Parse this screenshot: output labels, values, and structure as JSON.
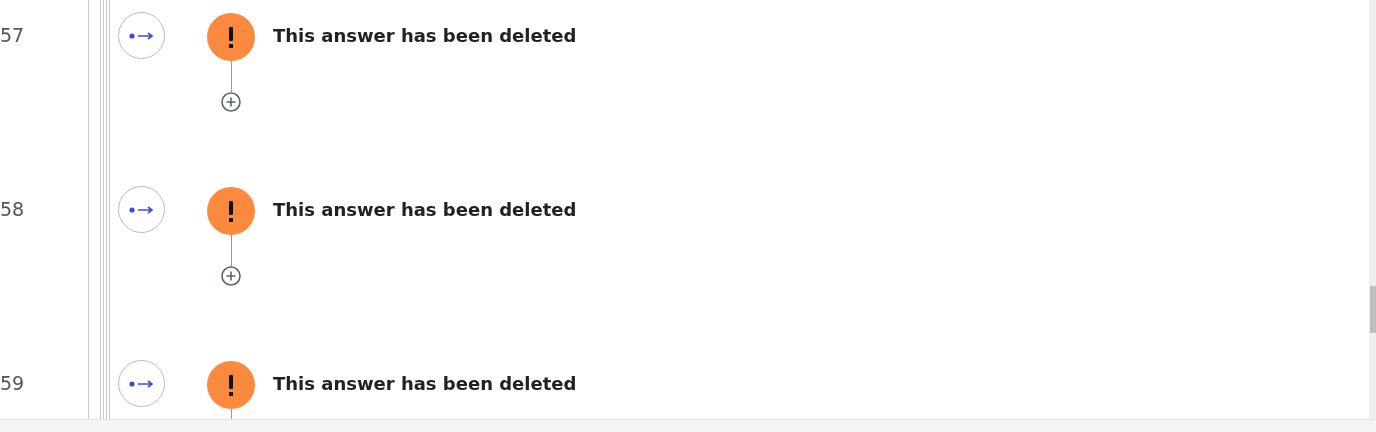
{
  "rows": [
    {
      "number": "57",
      "message": "This answer has been deleted",
      "add_button": true
    },
    {
      "number": "58",
      "message": "This answer has been deleted",
      "add_button": true
    },
    {
      "number": "59",
      "message": "This answer has been deleted",
      "add_button": false
    }
  ]
}
